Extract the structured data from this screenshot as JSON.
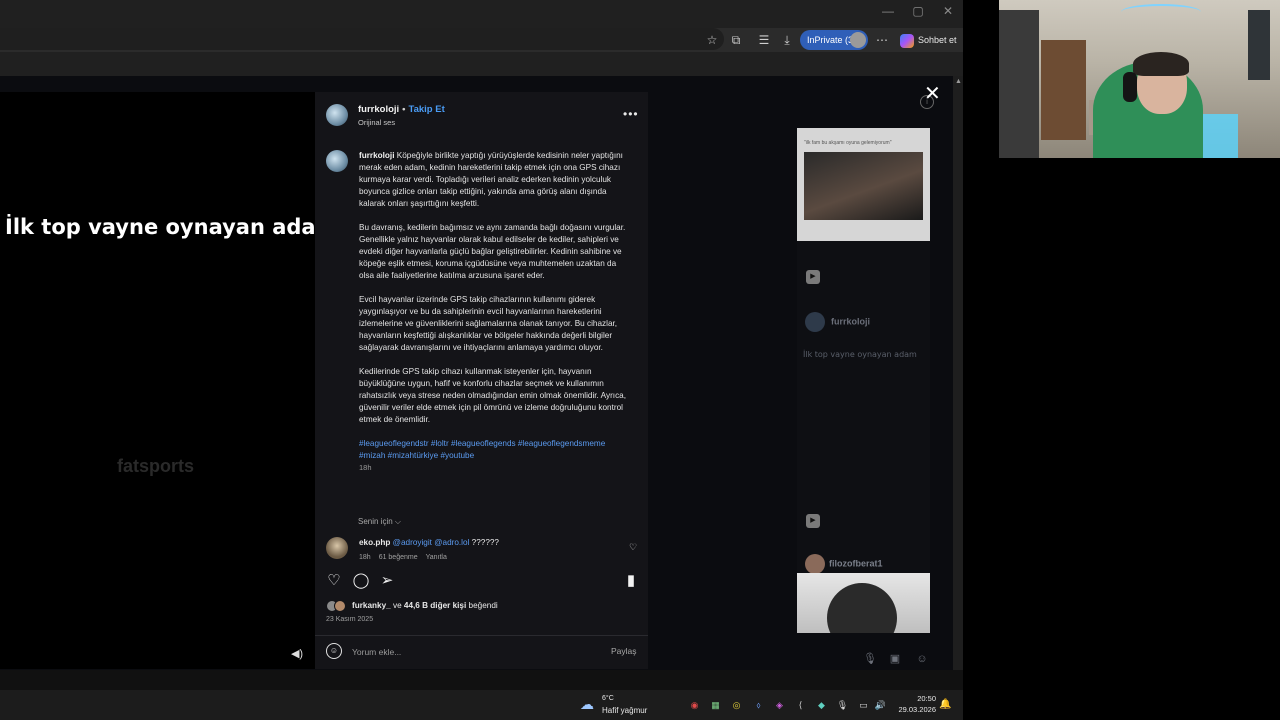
{
  "window": {
    "minimize": "—",
    "maximize": "▢",
    "close": "✕"
  },
  "toolbar": {
    "inprivate_label": "InPrivate (3)",
    "chat_label": "Sohbet et"
  },
  "video": {
    "caption": "İlk top vayne oynayan adam",
    "watermark": "fatsports"
  },
  "post": {
    "username": "furrkoloji",
    "separator": "•",
    "follow_label": "Takip Et",
    "audio_label": "Orijinal ses",
    "caption_username": "furrkoloji",
    "caption_p1": "Köpeğiyle birlikte yaptığı yürüyüşlerde kedisinin neler yaptığını merak eden adam, kedinin hareketlerini takip etmek için ona GPS cihazı kurmaya karar verdi. Topladığı verileri analiz ederken kedinin yolculuk boyunca gizlice onları takip ettiğini, yakında ama görüş alanı dışında kalarak onları şaşırttığını keşfetti.",
    "caption_p2": "Bu davranış, kedilerin bağımsız ve aynı zamanda bağlı doğasını vurgular. Genellikle yalnız hayvanlar olarak kabul edilseler de kediler, sahipleri ve evdeki diğer hayvanlarla güçlü bağlar geliştirebilirler. Kedinin sahibine ve köpeğe eşlik etmesi, koruma içgüdüsüne veya muhtemelen uzaktan da olsa aile faaliyetlerine katılma arzusuna işaret eder.",
    "caption_p3": "Evcil hayvanlar üzerinde GPS takip cihazlarının kullanımı giderek yaygınlaşıyor ve bu da sahiplerinin evcil hayvanlarının hareketlerini izlemelerine ve güvenliklerini sağlamalarına olanak tanıyor. Bu cihazlar, hayvanların keşfettiği alışkanlıklar ve bölgeler hakkında değerli bilgiler sağlayarak davranışlarını ve ihtiyaçlarını anlamaya yardımcı oluyor.",
    "caption_p4": "Kedilerinde GPS takip cihazı kullanmak isteyenler için, hayvanın büyüklüğüne uygun, hafif ve konforlu cihazlar seçmek ve kullanımın rahatsızlık veya strese neden olmadığından emin olmak önemlidir. Ayrıca, güvenilir veriler elde etmek için pil ömrünü ve izleme doğruluğunu kontrol etmek de önemlidir.",
    "hashtags": "#leagueoflegendstr #loltr #leagueoflegends #leagueoflegendsmeme #mizah #mizahtürkiye #youtube",
    "caption_time": "18h",
    "for_you_label": "Senin için ⌵",
    "comment": {
      "username": "eko.php",
      "mentions": "@adroyigit @adro.lol",
      "text": "??????",
      "time": "18h",
      "likes": "61 beğenme",
      "reply": "Yanıtla"
    },
    "liked_by_user": "furkanky_",
    "liked_by_and": "ve",
    "liked_by_others": "44,6 B diğer kişi",
    "liked_by_suffix": "beğendi",
    "date": "23 Kasım 2025",
    "comment_placeholder": "Yorum ekle...",
    "share_label": "Paylaş"
  },
  "side": {
    "card_caption": "\"ilk fam bu akşamı oyuna gelemiyorum\"",
    "user1": "furrkoloji",
    "caption": "İlk top vayne oynayan adam",
    "user2": "filozofberat1"
  },
  "taskbar": {
    "temp": "6°C",
    "weather": "Hafif yağmur",
    "time": "20:50",
    "date": "29.03.2026"
  },
  "icons": {
    "close": "✕",
    "more": "•••",
    "heart": "♡",
    "comment": "◯",
    "share": "➢",
    "bookmark": "▮",
    "mute": "◀)",
    "emoji": "☺",
    "play": "▶",
    "bell": "🔔"
  }
}
